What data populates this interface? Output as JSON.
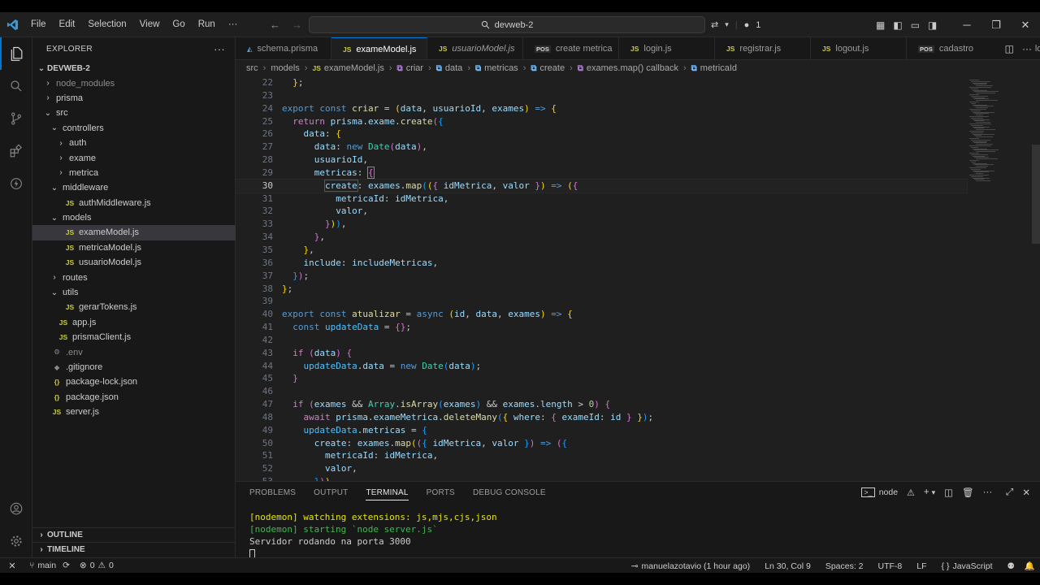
{
  "titlebar": {
    "menu": [
      "File",
      "Edit",
      "Selection",
      "View",
      "Go",
      "Run",
      "···"
    ],
    "search_text": "devweb-2",
    "notification_count": "1"
  },
  "sidebar": {
    "header": "EXPLORER",
    "root": "DEVWEB-2",
    "tree": [
      {
        "label": "node_modules",
        "depth": 1,
        "kind": "folder",
        "open": false,
        "dim": true
      },
      {
        "label": "prisma",
        "depth": 1,
        "kind": "folder",
        "open": false
      },
      {
        "label": "src",
        "depth": 1,
        "kind": "folder",
        "open": true
      },
      {
        "label": "controllers",
        "depth": 2,
        "kind": "folder",
        "open": true
      },
      {
        "label": "auth",
        "depth": 3,
        "kind": "folder",
        "open": false
      },
      {
        "label": "exame",
        "depth": 3,
        "kind": "folder",
        "open": false
      },
      {
        "label": "metrica",
        "depth": 3,
        "kind": "folder",
        "open": false
      },
      {
        "label": "middleware",
        "depth": 2,
        "kind": "folder",
        "open": true
      },
      {
        "label": "authMiddleware.js",
        "depth": 3,
        "kind": "js"
      },
      {
        "label": "models",
        "depth": 2,
        "kind": "folder",
        "open": true
      },
      {
        "label": "exameModel.js",
        "depth": 3,
        "kind": "js",
        "selected": true
      },
      {
        "label": "metricaModel.js",
        "depth": 3,
        "kind": "js"
      },
      {
        "label": "usuarioModel.js",
        "depth": 3,
        "kind": "js"
      },
      {
        "label": "routes",
        "depth": 2,
        "kind": "folder",
        "open": false
      },
      {
        "label": "utils",
        "depth": 2,
        "kind": "folder",
        "open": true
      },
      {
        "label": "gerarTokens.js",
        "depth": 3,
        "kind": "js"
      },
      {
        "label": "app.js",
        "depth": 2,
        "kind": "js"
      },
      {
        "label": "prismaClient.js",
        "depth": 2,
        "kind": "js"
      },
      {
        "label": ".env",
        "depth": 1,
        "kind": "env",
        "dim": true
      },
      {
        "label": ".gitignore",
        "depth": 1,
        "kind": "git"
      },
      {
        "label": "package-lock.json",
        "depth": 1,
        "kind": "json"
      },
      {
        "label": "package.json",
        "depth": 1,
        "kind": "json"
      },
      {
        "label": "server.js",
        "depth": 1,
        "kind": "js"
      }
    ],
    "outline": "OUTLINE",
    "timeline": "TIMELINE"
  },
  "tabs": [
    {
      "label": "schema.prisma",
      "icon": "prisma"
    },
    {
      "label": "exameModel.js",
      "icon": "JS",
      "active": true,
      "dirty": true
    },
    {
      "label": "usuarioModel.js",
      "icon": "JS",
      "italic": true
    },
    {
      "label": "create metrica",
      "icon": "POS"
    },
    {
      "label": "login.js",
      "icon": "JS"
    },
    {
      "label": "registrar.js",
      "icon": "JS"
    },
    {
      "label": "logout.js",
      "icon": "JS"
    },
    {
      "label": "cadastro",
      "icon": "POS"
    },
    {
      "label": "login",
      "icon": "POS"
    }
  ],
  "breadcrumb": [
    "src",
    "models",
    "exameModel.js",
    "criar",
    "data",
    "metricas",
    "create",
    "exames.map() callback",
    "metricaId"
  ],
  "editor": {
    "line_numbers": [
      "22",
      "23",
      "24",
      "25",
      "26",
      "27",
      "28",
      "29",
      "30",
      "31",
      "32",
      "33",
      "34",
      "35",
      "36",
      "37",
      "38",
      "39",
      "40",
      "41",
      "42",
      "43",
      "44",
      "45",
      "46",
      "47",
      "48",
      "49",
      "50",
      "51",
      "52",
      "53"
    ],
    "current_line": "30"
  },
  "panel": {
    "tabs": [
      "PROBLEMS",
      "OUTPUT",
      "TERMINAL",
      "PORTS",
      "DEBUG CONSOLE"
    ],
    "active_tab": "TERMINAL",
    "terminal_profile": "node",
    "terminal_lines": [
      "[nodemon] watching extensions: js,mjs,cjs,json",
      "[nodemon] starting `node server.js`",
      "Servidor rodando na porta 3000"
    ]
  },
  "statusbar": {
    "branch": "main",
    "errors": "0",
    "warnings": "0",
    "blame": "manuelazotavio (1 hour ago)",
    "position": "Ln 30, Col 9",
    "spaces": "Spaces: 2",
    "encoding": "UTF-8",
    "eol": "LF",
    "language": "JavaScript"
  },
  "colors": {
    "accent": "#0078d4",
    "editor_bg": "#1f1f1f",
    "sidebar_bg": "#181818",
    "js_icon": "#cbcb41"
  }
}
